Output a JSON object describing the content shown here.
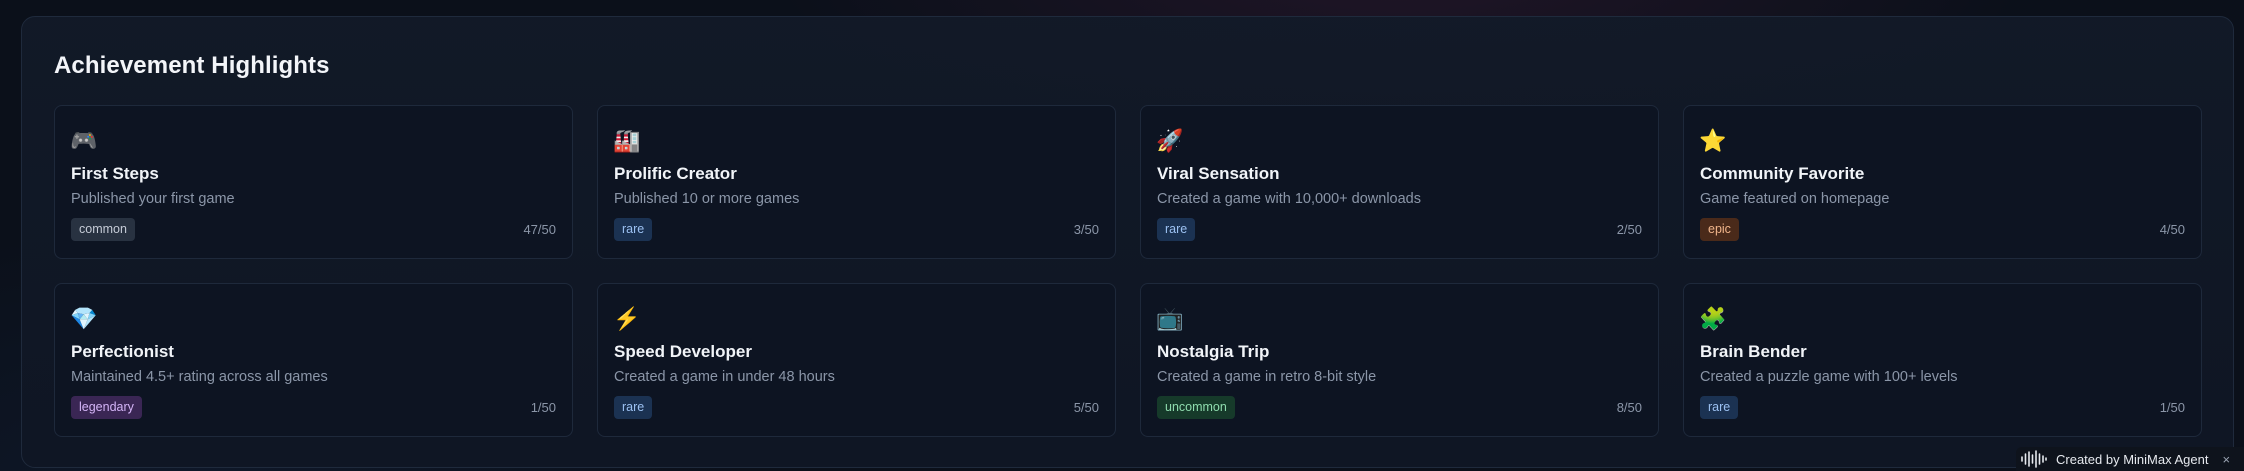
{
  "section": {
    "title": "Achievement Highlights"
  },
  "achievements": [
    {
      "icon": "🎮",
      "icon_name": "game-controller-icon",
      "title": "First Steps",
      "description": "Published your first game",
      "rarity": "common",
      "count": "47/50"
    },
    {
      "icon": "🏭",
      "icon_name": "factory-icon",
      "title": "Prolific Creator",
      "description": "Published 10 or more games",
      "rarity": "rare",
      "count": "3/50"
    },
    {
      "icon": "🚀",
      "icon_name": "rocket-icon",
      "title": "Viral Sensation",
      "description": "Created a game with 10,000+ downloads",
      "rarity": "rare",
      "count": "2/50"
    },
    {
      "icon": "⭐",
      "icon_name": "star-icon",
      "title": "Community Favorite",
      "description": "Game featured on homepage",
      "rarity": "epic",
      "count": "4/50"
    },
    {
      "icon": "💎",
      "icon_name": "gem-icon",
      "title": "Perfectionist",
      "description": "Maintained 4.5+ rating across all games",
      "rarity": "legendary",
      "count": "1/50"
    },
    {
      "icon": "⚡",
      "icon_name": "lightning-icon",
      "title": "Speed Developer",
      "description": "Created a game in under 48 hours",
      "rarity": "rare",
      "count": "5/50"
    },
    {
      "icon": "📺",
      "icon_name": "retro-tv-icon",
      "title": "Nostalgia Trip",
      "description": "Created a game in retro 8-bit style",
      "rarity": "uncommon",
      "count": "8/50"
    },
    {
      "icon": "🧩",
      "icon_name": "puzzle-piece-icon",
      "title": "Brain Bender",
      "description": "Created a puzzle game with 100+ levels",
      "rarity": "rare",
      "count": "1/50"
    }
  ],
  "footer": {
    "label": "Created by MiniMax Agent",
    "close": "×"
  },
  "colors": {
    "common": "#283241",
    "rare": "#1b3252",
    "epic": "#4a2a1a",
    "legendary": "#3a2654",
    "uncommon": "#163a2a"
  }
}
